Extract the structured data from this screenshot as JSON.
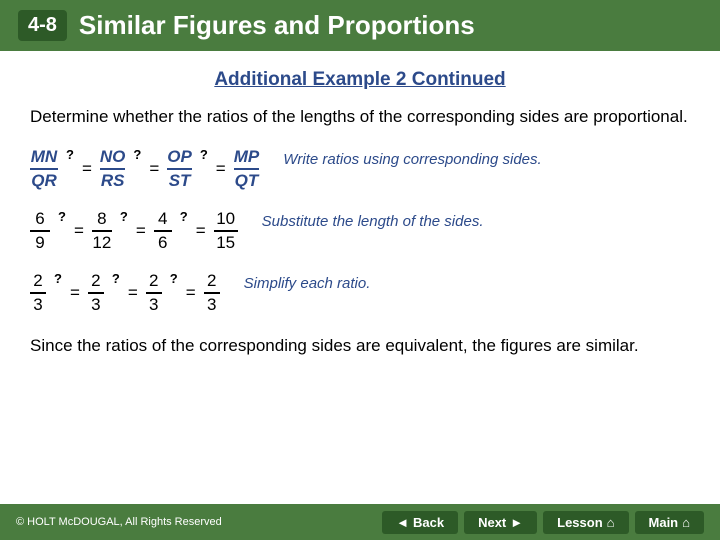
{
  "header": {
    "badge": "4-8",
    "title": "Similar Figures and Proportions"
  },
  "section_title": "Additional Example 2 Continued",
  "description": "Determine whether the ratios of the lengths of the corresponding sides are proportional.",
  "steps": [
    {
      "id": "step1",
      "math_fractions": [
        {
          "numer": "MN",
          "denom": "QR",
          "style": "italic-blue"
        },
        {
          "numer": "NO",
          "denom": "RS",
          "style": "italic-blue"
        },
        {
          "numer": "OP",
          "denom": "ST",
          "style": "italic-blue"
        },
        {
          "numer": "MP",
          "denom": "QT",
          "style": "italic-blue"
        }
      ],
      "explanation": "Write ratios using corresponding sides."
    },
    {
      "id": "step2",
      "math_fractions": [
        {
          "numer": "6",
          "denom": "9",
          "style": "normal"
        },
        {
          "numer": "8",
          "denom": "12",
          "style": "normal"
        },
        {
          "numer": "4",
          "denom": "6",
          "style": "normal"
        },
        {
          "numer": "10",
          "denom": "15",
          "style": "normal"
        }
      ],
      "explanation": "Substitute the length of the sides."
    },
    {
      "id": "step3",
      "math_fractions": [
        {
          "numer": "2",
          "denom": "3",
          "style": "normal"
        },
        {
          "numer": "2",
          "denom": "3",
          "style": "normal"
        },
        {
          "numer": "2",
          "denom": "3",
          "style": "normal"
        },
        {
          "numer": "2",
          "denom": "3",
          "style": "normal"
        }
      ],
      "explanation": "Simplify each ratio."
    }
  ],
  "conclusion": "Since the ratios of the corresponding sides are equivalent, the figures are similar.",
  "footer": {
    "copyright": "© HOLT McDOUGAL, All Rights Reserved",
    "buttons": [
      {
        "label": "Back",
        "arrow": "◄"
      },
      {
        "label": "Next",
        "arrow": "►"
      },
      {
        "label": "Lesson",
        "arrow": ""
      },
      {
        "label": "Main",
        "arrow": "⌂"
      }
    ]
  }
}
